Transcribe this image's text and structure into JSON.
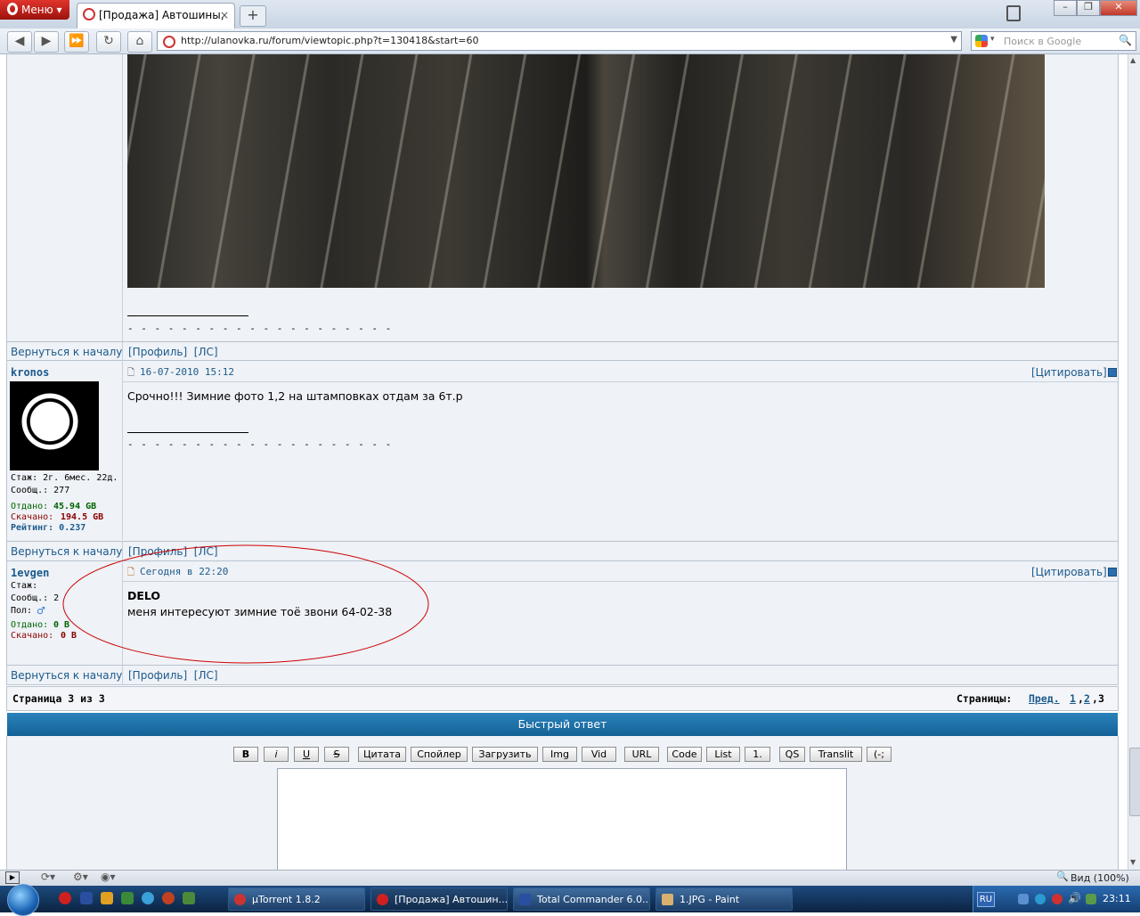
{
  "browser": {
    "menu_label": "Меню",
    "tab_title": "[Продажа] Автошины, ...",
    "tab_close": "×",
    "new_tab": "+",
    "url": "http://ulanovka.ru/forum/viewtopic.php?t=130418&start=60",
    "search_placeholder": "Поиск в Google",
    "zoom_label": "Вид (100%)"
  },
  "forum": {
    "back_to_top": "Вернуться к началу",
    "profile_links": "[Профиль]  [ЛС]",
    "sig_dashes": "- - - - - - - - - - - - - - - - - - - -",
    "posts": [
      {
        "author": "kronos",
        "date": "16-07-2010 15:12",
        "quote": "[Цитировать]",
        "stazh": "Стаж: 2г. 6мес. 22д.",
        "messages": "Сообщ.: 277",
        "given_label": "Отдано:",
        "given": "45.94 GB",
        "downloaded_label": "Скачано:",
        "downloaded": "194.5 GB",
        "rating": "Рейтинг: 0.237",
        "text": "Срочно!!! Зимние фото 1,2 на штамповках отдам за 6т.р"
      },
      {
        "author": "1evgen",
        "date": "Сегодня в 22:20",
        "quote": "[Цитировать]",
        "stazh": "Стаж:",
        "messages": "Сообщ.: 2",
        "gender_label": "Пол:",
        "given_label": "Отдано:",
        "given": "0 B",
        "downloaded_label": "Скачано:",
        "downloaded": "0 B",
        "title_line": "DELO",
        "text": "меня интересуют зимние тоё звони 64-02-38"
      }
    ],
    "page_info": "Страница 3 из 3",
    "pages_label": "Страницы:",
    "prev": "Пред.",
    "page1": "1",
    "page2": "2",
    "page3": "3",
    "quick_reply": "Быстрый ответ",
    "bbcode_buttons": [
      "B",
      "i",
      "U",
      "S",
      "Цитата",
      "Спойлер",
      "Загрузить",
      "Img",
      "Vid",
      "URL",
      "Code",
      "List",
      "1.",
      "QS",
      "Translit",
      "(-;"
    ]
  },
  "taskbar": {
    "tasks": [
      "µTorrent 1.8.2",
      "[Продажа] Автошин...",
      "Total Commander 6.0...",
      "1.JPG - Paint"
    ],
    "lang": "RU",
    "clock": "23:11"
  },
  "colors": {
    "link": "#1b5a8c",
    "given": "#006400",
    "downloaded": "#8b0000",
    "quick_reply_bar": "#1a6fa3",
    "annotation": "#cc0000"
  }
}
